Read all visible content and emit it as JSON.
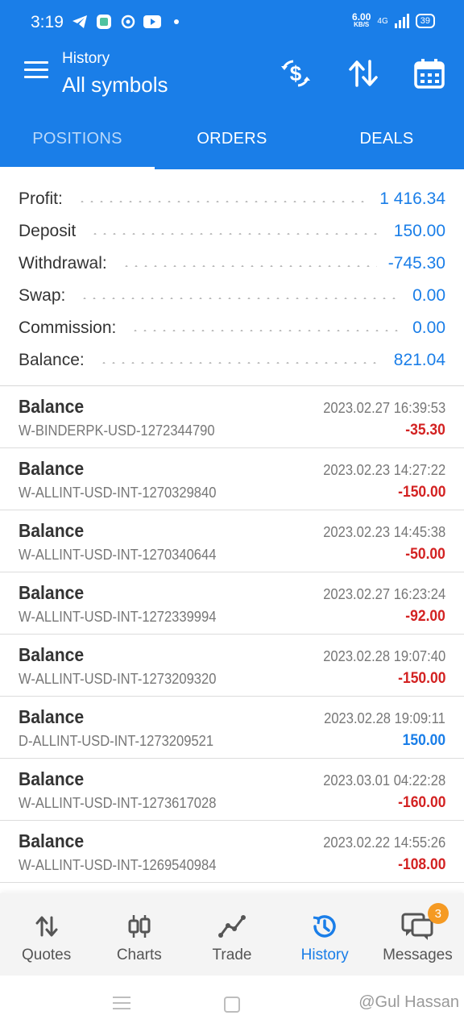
{
  "status_bar": {
    "time": "3:19",
    "net_speed": "6.00",
    "net_unit": "KB/S",
    "network": "4G",
    "battery": "39"
  },
  "app_bar": {
    "subtitle": "History",
    "title": "All symbols"
  },
  "tabs": [
    {
      "label": "POSITIONS",
      "active": true
    },
    {
      "label": "ORDERS",
      "active": false
    },
    {
      "label": "DEALS",
      "active": false
    }
  ],
  "summary": [
    {
      "label": "Profit:",
      "value": "1 416.34"
    },
    {
      "label": "Deposit",
      "value": "150.00"
    },
    {
      "label": "Withdrawal:",
      "value": "-745.30"
    },
    {
      "label": "Swap:",
      "value": "0.00"
    },
    {
      "label": "Commission:",
      "value": "0.00"
    },
    {
      "label": "Balance:",
      "value": "821.04"
    }
  ],
  "deals": [
    {
      "type": "Balance",
      "comment": "W-BINDERPK-USD-1272344790",
      "time": "2023.02.27 16:39:53",
      "amount": "-35.30",
      "sign": "neg"
    },
    {
      "type": "Balance",
      "comment": "W-ALLINT-USD-INT-1270329840",
      "time": "2023.02.23 14:27:22",
      "amount": "-150.00",
      "sign": "neg"
    },
    {
      "type": "Balance",
      "comment": "W-ALLINT-USD-INT-1270340644",
      "time": "2023.02.23 14:45:38",
      "amount": "-50.00",
      "sign": "neg"
    },
    {
      "type": "Balance",
      "comment": "W-ALLINT-USD-INT-1272339994",
      "time": "2023.02.27 16:23:24",
      "amount": "-92.00",
      "sign": "neg"
    },
    {
      "type": "Balance",
      "comment": "W-ALLINT-USD-INT-1273209320",
      "time": "2023.02.28 19:07:40",
      "amount": "-150.00",
      "sign": "neg"
    },
    {
      "type": "Balance",
      "comment": "D-ALLINT-USD-INT-1273209521",
      "time": "2023.02.28 19:09:11",
      "amount": "150.00",
      "sign": "pos"
    },
    {
      "type": "Balance",
      "comment": "W-ALLINT-USD-INT-1273617028",
      "time": "2023.03.01 04:22:28",
      "amount": "-160.00",
      "sign": "neg"
    },
    {
      "type": "Balance",
      "comment": "W-ALLINT-USD-INT-1269540984",
      "time": "2023.02.22 14:55:26",
      "amount": "-108.00",
      "sign": "neg"
    }
  ],
  "bottom_nav": [
    {
      "label": "Quotes",
      "icon": "quotes-arrows-icon",
      "active": false
    },
    {
      "label": "Charts",
      "icon": "candlestick-icon",
      "active": false
    },
    {
      "label": "Trade",
      "icon": "trade-line-icon",
      "active": false
    },
    {
      "label": "History",
      "icon": "history-clock-icon",
      "active": true
    },
    {
      "label": "Messages",
      "icon": "messages-icon",
      "active": false,
      "badge": "3"
    }
  ],
  "watermark": "@Gul Hassan",
  "colors": {
    "accent": "#1a7ee8",
    "negative": "#d32222",
    "badge": "#f59a23"
  }
}
